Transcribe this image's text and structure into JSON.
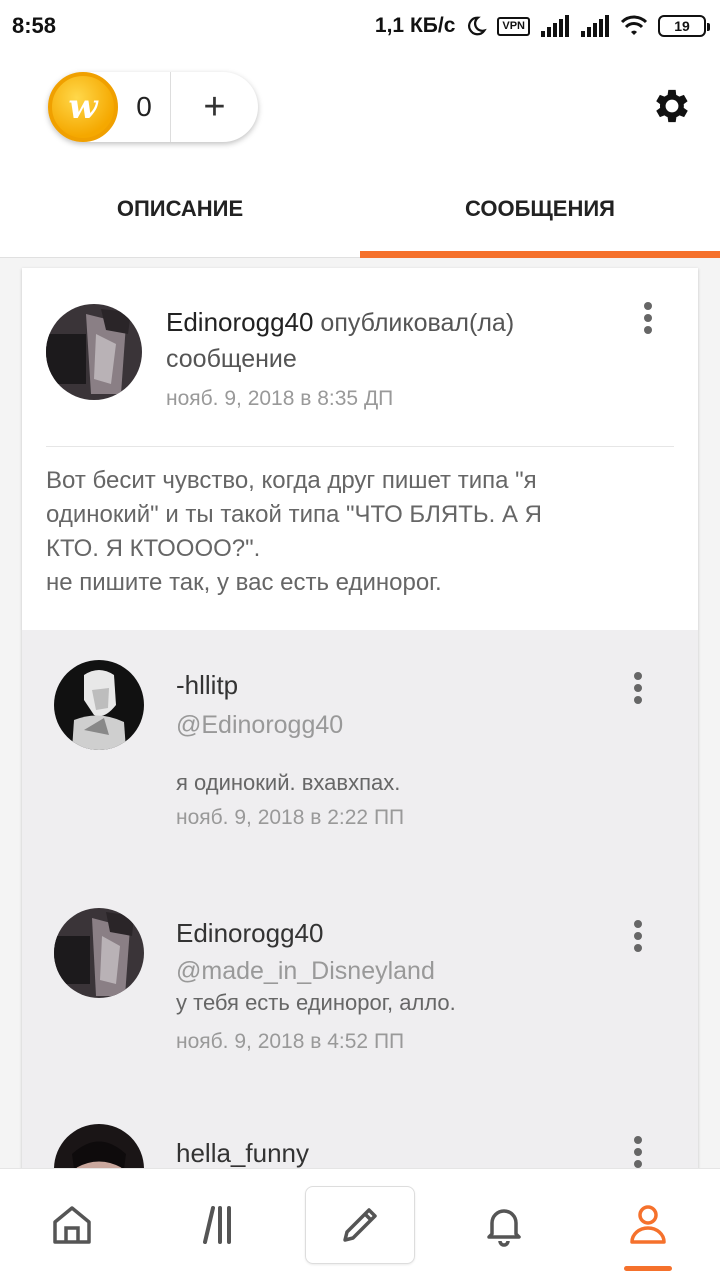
{
  "status_bar": {
    "time": "8:58",
    "speed": "1,1 КБ/с",
    "vpn": "VPN",
    "battery": "19"
  },
  "header": {
    "coin_letter": "w",
    "coin_count": "0",
    "add_label": "+"
  },
  "tabs": [
    {
      "label": "ОПИСАНИЕ",
      "active": false
    },
    {
      "label": "СООБЩЕНИЯ",
      "active": true
    }
  ],
  "post": {
    "author": "Edinorogg40",
    "action_line1": " опубликовал(ла)",
    "action_line2": "сообщение",
    "date": "нояб. 9, 2018 в 8:35 ДП",
    "body": [
      "Вот бесит чувство, когда друг пишет типа \"я",
      "одинокий\" и ты такой типа \"ЧТО БЛЯТЬ. А Я",
      "КТО. Я КТОООО?\".",
      "не пишите так, у вас есть единорог."
    ]
  },
  "comments": [
    {
      "author": "-hllitp",
      "mention": "@Edinorogg40",
      "message": "я одинокий. вхавхпах.",
      "date": "нояб. 9, 2018 в 2:22 ПП"
    },
    {
      "author": "Edinorogg40",
      "mention": "@made_in_Disneyland",
      "message": "у тебя есть единорог, алло.",
      "date": "нояб. 9, 2018 в 4:52 ПП"
    },
    {
      "author": "hella_funny"
    }
  ],
  "bottom_nav": {
    "items": [
      "home-icon",
      "library-icon",
      "write-icon",
      "notifications-icon",
      "profile-icon"
    ],
    "active": "profile-icon"
  },
  "colors": {
    "accent": "#f5712c",
    "coin": "#f5a800",
    "comments_bg": "#efeef0"
  }
}
